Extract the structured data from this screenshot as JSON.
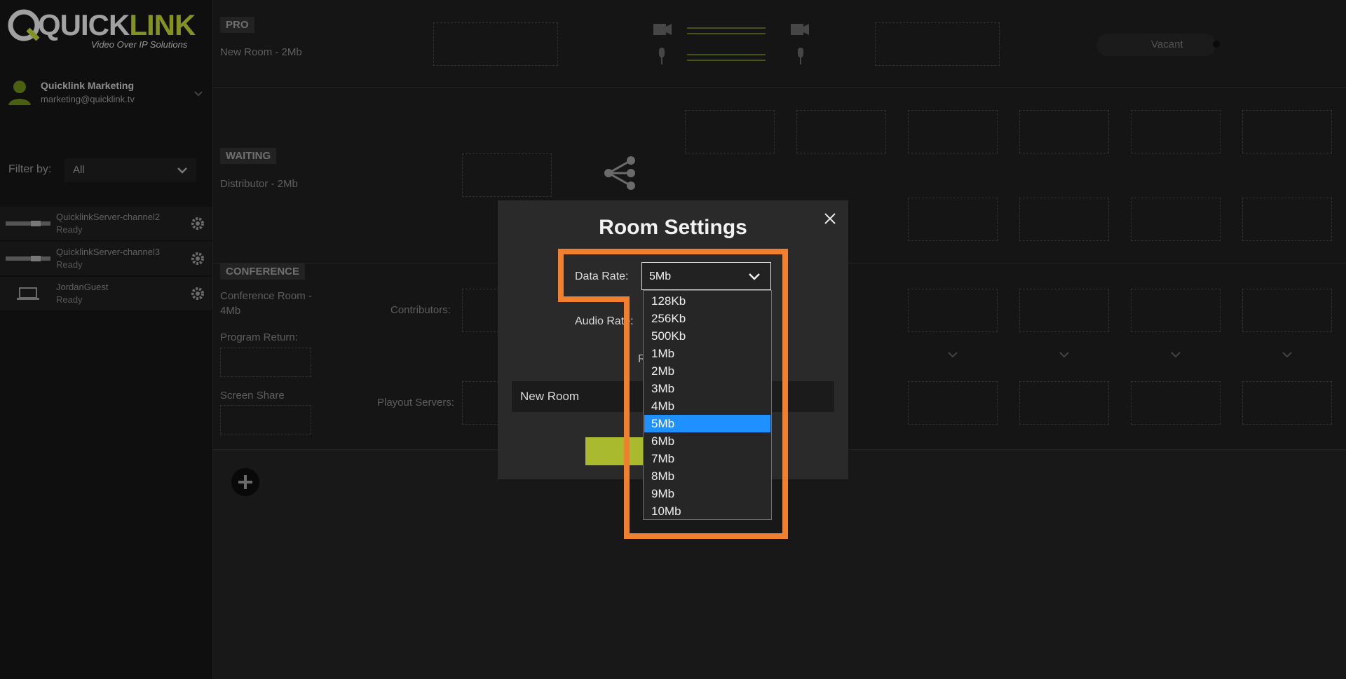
{
  "brand": {
    "name_main": "QUICK",
    "name_accent": "LINK",
    "tagline": "Video Over IP Solutions"
  },
  "user": {
    "name": "Quicklink Marketing",
    "email": "marketing@quicklink.tv"
  },
  "filter": {
    "label": "Filter by:",
    "value": "All"
  },
  "devices": [
    {
      "name": "QuicklinkServer-channel2",
      "status": "Ready"
    },
    {
      "name": "QuicklinkServer-channel3",
      "status": "Ready"
    },
    {
      "name": "JordanGuest",
      "status": "Ready"
    }
  ],
  "rooms": {
    "pro": {
      "tag": "PRO",
      "name": "New Room - 2Mb",
      "toggle_label": "Vacant"
    },
    "waiting": {
      "tag": "WAITING",
      "name": "Distributor - 2Mb"
    },
    "conference": {
      "tag": "CONFERENCE",
      "name": "Conference Room - 4Mb",
      "program_return": "Program Return:",
      "screen_share": "Screen Share",
      "contributors": "Contributors:",
      "playout_servers": "Playout Servers:"
    }
  },
  "modal": {
    "title": "Room Settings",
    "data_rate_label": "Data Rate:",
    "data_rate_value": "5Mb",
    "audio_rate_label": "Audio Rate:",
    "r_label": "R",
    "room_name_value": "New Room",
    "data_rate_options": [
      "128Kb",
      "256Kb",
      "500Kb",
      "1Mb",
      "2Mb",
      "3Mb",
      "4Mb",
      "5Mb",
      "6Mb",
      "7Mb",
      "8Mb",
      "9Mb",
      "10Mb"
    ],
    "selected_option": "5Mb"
  },
  "colors": {
    "accent": "#a9ba2e",
    "highlight": "#f07f2e",
    "selected": "#1e90ff"
  }
}
